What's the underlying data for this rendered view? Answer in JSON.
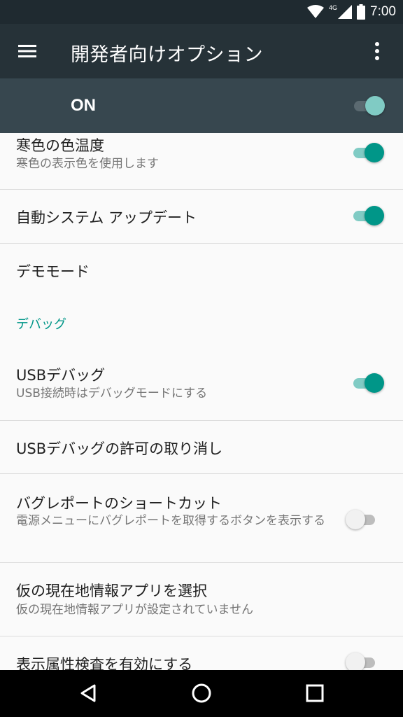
{
  "status_bar": {
    "time": "7:00",
    "network": "4G",
    "icons": [
      "wifi-icon",
      "cellular-signal-icon",
      "battery-icon"
    ]
  },
  "app_bar": {
    "title": "開発者向けオプション",
    "menu_icon": "hamburger-menu-icon",
    "overflow_icon": "more-vert-icon"
  },
  "master_switch": {
    "label": "ON",
    "checked": true
  },
  "settings": {
    "cool_color": {
      "title": "寒色の色温度",
      "summary": "寒色の表示色を使用します",
      "checked": true
    },
    "auto_update": {
      "title": "自動システム アップデート",
      "checked": true
    },
    "demo_mode": {
      "title": "デモモード"
    },
    "debug_category": "デバッグ",
    "usb_debug": {
      "title": "USBデバッグ",
      "summary": "USB接続時はデバッグモードにする",
      "checked": true
    },
    "revoke_usb": {
      "title": "USBデバッグの許可の取り消し"
    },
    "bugreport_shortcut": {
      "title": "バグレポートのショートカット",
      "summary": "電源メニューにバグレポートを取得するボタンを表示する",
      "checked": false
    },
    "mock_location": {
      "title": "仮の現在地情報アプリを選択",
      "summary": "仮の現在地情報アプリが設定されていません"
    },
    "view_attr": {
      "title": "表示属性検査を有効にする",
      "checked": false
    }
  },
  "nav_bar": {
    "icons": [
      "back-icon",
      "home-icon",
      "recents-icon"
    ]
  },
  "colors": {
    "status_bar": "#1f2a30",
    "app_bar": "#263238",
    "master_bar": "#37474f",
    "accent": "#009688",
    "background": "#fafafa"
  }
}
